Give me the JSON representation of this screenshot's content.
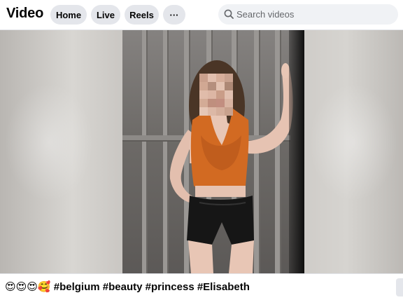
{
  "header": {
    "title": "Video",
    "tabs": [
      {
        "label": "Home"
      },
      {
        "label": "Live"
      },
      {
        "label": "Reels"
      }
    ],
    "more_label": "···",
    "search": {
      "placeholder": "Search videos",
      "value": "",
      "icon": "search-icon"
    }
  },
  "video": {
    "caption": "😍😍😍🥰 #belgium #beauty #princess #Elisabeth"
  },
  "colors": {
    "pill_bg": "#e4e6eb",
    "search_bg": "#f0f2f5",
    "top": "#855f3e",
    "shorts": "#161616"
  }
}
